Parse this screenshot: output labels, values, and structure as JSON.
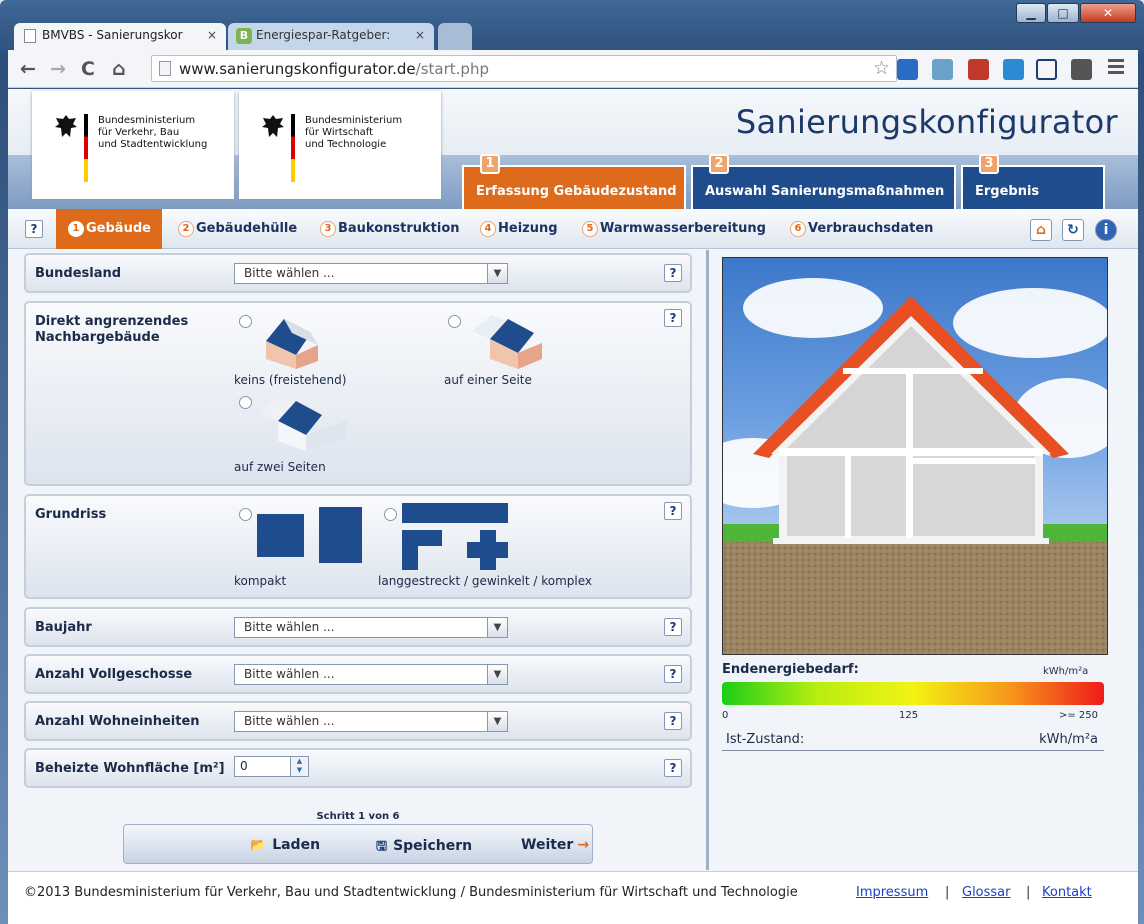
{
  "browser": {
    "tabs": [
      {
        "title": "BMVBS - Sanierungskor",
        "close": "×"
      },
      {
        "title": "Energiespar-Ratgeber:",
        "close": "×",
        "icon_letter": "B"
      }
    ],
    "window_buttons": {
      "minimize": "▁",
      "maximize": "□",
      "close": "✕"
    },
    "nav": {
      "back": "←",
      "forward": "→",
      "reload": "C",
      "home": "⌂"
    },
    "url_domain": "www.sanierungskonfigurator.de",
    "url_path": "/start.php",
    "bookmark_star": "☆"
  },
  "header": {
    "logos": [
      {
        "line1": "Bundesministerium",
        "line2": "für Verkehr, Bau",
        "line3": "und Stadtentwicklung"
      },
      {
        "line1": "Bundesministerium",
        "line2": "für Wirtschaft",
        "line3": "und Technologie"
      }
    ],
    "app_title": "Sanierungskonfigurator",
    "steps": [
      {
        "num": "1",
        "label": "Erfassung Gebäudezustand"
      },
      {
        "num": "2",
        "label": "Auswahl Sanierungsmaßnahmen"
      },
      {
        "num": "3",
        "label": "Ergebnis"
      }
    ]
  },
  "subnav": {
    "help": "?",
    "items": [
      {
        "num": "1",
        "label": "Gebäude"
      },
      {
        "num": "2",
        "label": "Gebäudehülle"
      },
      {
        "num": "3",
        "label": "Baukonstruktion"
      },
      {
        "num": "4",
        "label": "Heizung"
      },
      {
        "num": "5",
        "label": "Warmwasserbereitung"
      },
      {
        "num": "6",
        "label": "Verbrauchsdaten"
      }
    ],
    "tool_icons": [
      "home-icon",
      "refresh-icon",
      "info-icon"
    ],
    "tool_glyphs": {
      "home": "⌂",
      "refresh": "↻",
      "info": "i"
    }
  },
  "form": {
    "help": "?",
    "select_placeholder": "Bitte wählen ...",
    "dropdown_arrow": "▼",
    "bundesland": {
      "label": "Bundesland"
    },
    "nachbar": {
      "label_line1": "Direkt angrenzendes",
      "label_line2": "Nachbargebäude",
      "options": [
        "keins (freistehend)",
        "auf einer Seite",
        "auf zwei Seiten"
      ]
    },
    "grundriss": {
      "label": "Grundriss",
      "options": [
        "kompakt",
        "langgestreckt / gewinkelt / komplex"
      ]
    },
    "baujahr": {
      "label": "Baujahr"
    },
    "vollgeschosse": {
      "label": "Anzahl Vollgeschosse"
    },
    "wohneinheiten": {
      "label": "Anzahl Wohneinheiten"
    },
    "wohnflaeche": {
      "label": "Beheizte Wohnfläche [m²]",
      "value": "0",
      "up": "▲",
      "down": "▼"
    }
  },
  "wizard": {
    "step_info": "Schritt 1 von 6",
    "load": "Laden",
    "save": "Speichern",
    "next": "Weiter",
    "load_icon": "📂",
    "save_icon": "🖫",
    "next_arrow": "→"
  },
  "energy": {
    "label": "Endenergiebedarf:",
    "unit_top": "kWh/m²a",
    "scale_min": "0",
    "scale_mid": "125",
    "scale_max": ">= 250",
    "ist_label": "Ist-Zustand:",
    "ist_unit": "kWh/m²a",
    "colors": [
      "#1ccd18",
      "#f2f312",
      "#ee1b1b"
    ]
  },
  "footer": {
    "copyright": "©2013 Bundesministerium für Verkehr, Bau und Stadtentwicklung / Bundesministerium für Wirtschaft und Technologie",
    "links": [
      "Impressum",
      "Glossar",
      "Kontakt"
    ],
    "separator": "|"
  },
  "colors": {
    "accent": "#de6a1b",
    "brand": "#1f4c8c"
  }
}
